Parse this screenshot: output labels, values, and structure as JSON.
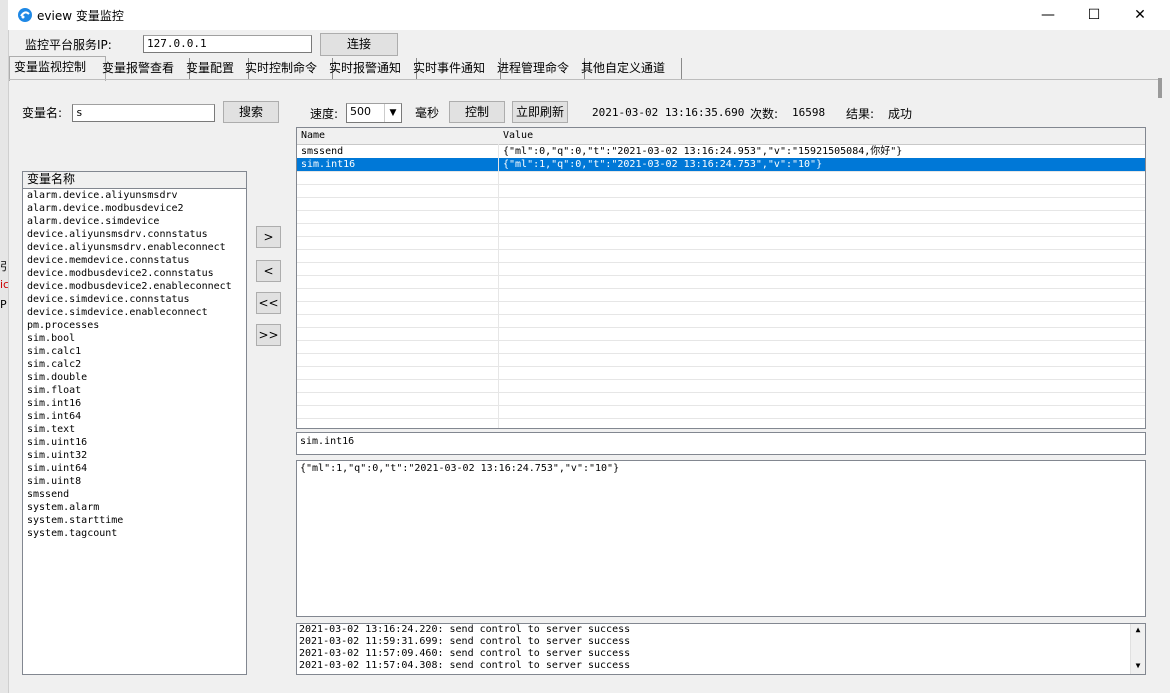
{
  "window": {
    "title": "eview 变量监控",
    "minimize": "—",
    "maximize": "☐",
    "close": "✕"
  },
  "left_strip": [
    "引",
    "ic",
    "P"
  ],
  "server": {
    "label": "监控平台服务IP:",
    "ip": "127.0.0.1",
    "connect": "连接"
  },
  "tabs": [
    "变量监视控制",
    "变量报警查看",
    "变量配置",
    "实时控制命令",
    "实时报警通知",
    "实时事件通知",
    "进程管理命令",
    "其他自定义通道"
  ],
  "search": {
    "label": "变量名:",
    "value": "s",
    "button": "搜索"
  },
  "controls": {
    "speed_label": "速度:",
    "speed_value": "500",
    "unit": "毫秒",
    "control_button": "控制",
    "refresh_button": "立即刷新",
    "timestamp": "2021-03-02 13:16:35.690",
    "count_label": "次数:",
    "count_value": "16598",
    "result_label": "结果:",
    "result_value": "成功"
  },
  "variable_list": {
    "header": "变量名称",
    "items": [
      "alarm.device.aliyunsmsdrv",
      "alarm.device.modbusdevice2",
      "alarm.device.simdevice",
      "device.aliyunsmsdrv.connstatus",
      "device.aliyunsmsdrv.enableconnect",
      "device.memdevice.connstatus",
      "device.modbusdevice2.connstatus",
      "device.modbusdevice2.enableconnect",
      "device.simdevice.connstatus",
      "device.simdevice.enableconnect",
      "pm.processes",
      "sim.bool",
      "sim.calc1",
      "sim.calc2",
      "sim.double",
      "sim.float",
      "sim.int16",
      "sim.int64",
      "sim.text",
      "sim.uint16",
      "sim.uint32",
      "sim.uint64",
      "sim.uint8",
      "smssend",
      "system.alarm",
      "system.starttime",
      "system.tagcount"
    ]
  },
  "move_buttons": [
    ">",
    "<",
    "<<",
    ">>"
  ],
  "grid": {
    "columns": [
      "Name",
      "Value"
    ],
    "rows": [
      {
        "name": "smssend",
        "value": "{\"ml\":0,\"q\":0,\"t\":\"2021-03-02 13:16:24.953\",\"v\":\"15921505084,你好\"}"
      },
      {
        "name": "sim.int16",
        "value": "{\"ml\":1,\"q\":0,\"t\":\"2021-03-02 13:16:24.753\",\"v\":\"10\"}"
      }
    ]
  },
  "selected_name": "sim.int16",
  "selected_value": "{\"ml\":1,\"q\":0,\"t\":\"2021-03-02 13:16:24.753\",\"v\":\"10\"}",
  "log": [
    "2021-03-02 13:16:24.220: send control to server success",
    "2021-03-02 11:59:31.699: send control to server success",
    "2021-03-02 11:57:09.460: send control to server success",
    "2021-03-02 11:57:04.308: send control to server success"
  ],
  "scroll": {
    "up": "▲",
    "down": "▼"
  }
}
